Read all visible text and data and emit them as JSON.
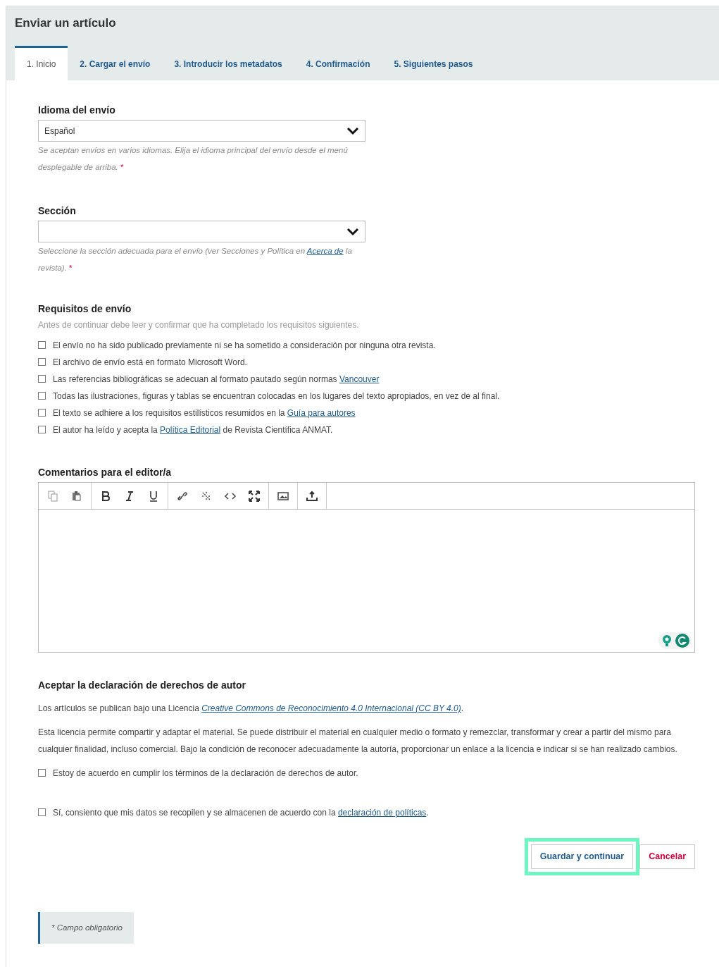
{
  "title": "Enviar un artículo",
  "tabs": [
    {
      "label": "1. Inicio",
      "selected": true
    },
    {
      "label": "2. Cargar el envío",
      "selected": false
    },
    {
      "label": "3. Introducir los metadatos",
      "selected": false
    },
    {
      "label": "4. Confirmación",
      "selected": false
    },
    {
      "label": "5. Siguientes pasos",
      "selected": false
    }
  ],
  "language": {
    "label": "Idioma del envío",
    "value": "Español",
    "help": [
      {
        "kind": "text",
        "text": "Se aceptan envíos en varios idiomas. Elija el idioma principal del envío desde el menú desplegable de arriba."
      },
      {
        "kind": "required",
        "text": "*"
      }
    ]
  },
  "section": {
    "label": "Sección",
    "help": [
      {
        "kind": "text",
        "text": "Seleccione la sección adecuada para el envío (ver Secciones y Política en "
      },
      {
        "kind": "link",
        "text": "Acerca de"
      },
      {
        "kind": "text",
        "text": " la revista)."
      },
      {
        "kind": "required",
        "text": "*"
      }
    ]
  },
  "requirements": {
    "title": "Requisitos de envío",
    "intro": "Antes de continuar debe leer y confirmar que ha completado los requisitos siguientes.",
    "items": [
      {
        "checked": false,
        "parts": [
          {
            "kind": "text",
            "text": "El envío no ha sido publicado previamente ni se ha sometido a consideración por ninguna otra revista."
          }
        ]
      },
      {
        "checked": false,
        "parts": [
          {
            "kind": "text",
            "text": "El archivo de envío está en formato Microsoft Word."
          }
        ]
      },
      {
        "checked": false,
        "parts": [
          {
            "kind": "text",
            "text": "Las referencias bibliográficas se adecuan al formato pautado según normas "
          },
          {
            "kind": "link",
            "text": "Vancouver"
          }
        ]
      },
      {
        "checked": false,
        "parts": [
          {
            "kind": "text",
            "text": "Todas las ilustraciones, figuras y tablas se encuentran colocadas en los lugares del texto apropiados, en vez de al final."
          }
        ]
      },
      {
        "checked": false,
        "parts": [
          {
            "kind": "text",
            "text": "El texto se adhiere a los requisitos estilísticos resumidos en la "
          },
          {
            "kind": "link",
            "text": "Guía para autores"
          }
        ]
      },
      {
        "checked": false,
        "parts": [
          {
            "kind": "text",
            "text": "El autor ha leído y acepta la "
          },
          {
            "kind": "link",
            "text": "Política Editorial"
          },
          {
            "kind": "text",
            "text": " de Revista Científica ANMAT."
          }
        ]
      }
    ]
  },
  "comments": {
    "label": "Comentarios para el editor/a",
    "toolbar": [
      [
        {
          "kind": "copy"
        },
        {
          "kind": "paste"
        }
      ],
      [
        {
          "kind": "bold"
        },
        {
          "kind": "italic"
        },
        {
          "kind": "underline"
        }
      ],
      [
        {
          "kind": "link"
        },
        {
          "kind": "unlink"
        },
        {
          "kind": "code"
        },
        {
          "kind": "fullscreen"
        }
      ],
      [
        {
          "kind": "image"
        }
      ],
      [
        {
          "kind": "upload"
        }
      ]
    ]
  },
  "copyright": {
    "title": "Aceptar la declaración de derechos de autor",
    "paragraphs": [
      [
        {
          "kind": "text",
          "text": "Los artículos se publican bajo una Licencia "
        },
        {
          "kind": "emlink",
          "text": "Creative Commons de Reconocimiento 4.0 Internacional (CC BY 4.0)"
        },
        {
          "kind": "text",
          "text": "."
        }
      ],
      [
        {
          "kind": "text",
          "text": "Esta licencia permite compartir y adaptar el material. Se puede distribuir el material en cualquier medio o formato y remezclar, transformar y crear a partir del mismo para cualquier finalidad, incluso comercial. Bajo la condición de reconocer adecuadamente la autoría, proporcionar un enlace a la licencia e indicar si se han realizado cambios."
        }
      ]
    ],
    "items": [
      {
        "checked": false,
        "parts": [
          {
            "kind": "text",
            "text": "Estoy de acuerdo en cumplir los términos de la declaración de derechos de autor."
          }
        ]
      },
      {
        "checked": false,
        "parts": [
          {
            "kind": "text",
            "text": "Sí, consiento que mis datos se recopilen y se almacenen de acuerdo con la "
          },
          {
            "kind": "link",
            "text": "declaración de políticas"
          },
          {
            "kind": "text",
            "text": "."
          }
        ]
      }
    ]
  },
  "buttons": [
    {
      "label": "Guardar y continuar",
      "kind": "primary",
      "highlighted": true
    },
    {
      "label": "Cancelar",
      "kind": "cancel",
      "highlighted": false
    }
  ],
  "footnote": "* Campo obligatorio"
}
